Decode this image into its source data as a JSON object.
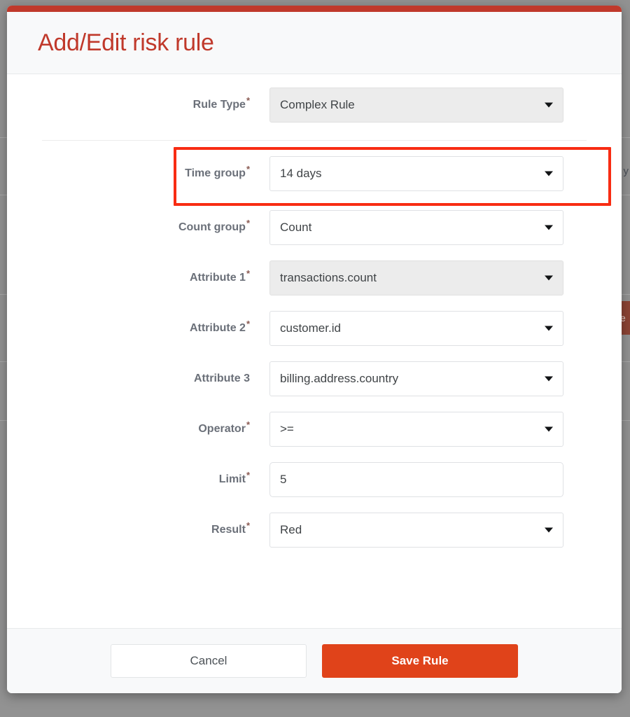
{
  "background": {
    "right_text": "y",
    "right_badge": "ve"
  },
  "modal": {
    "title": "Add/Edit risk rule",
    "accent_color": "#c0392b",
    "highlight_color": "#f82c13",
    "required_marker": "*",
    "caret_icon": "chevron-down-icon",
    "form": {
      "rows": [
        {
          "label": "Rule Type",
          "required": true,
          "control": "select",
          "value": "Complex Rule",
          "disabled": true,
          "highlighted": false
        },
        {
          "label": "Time group",
          "required": true,
          "control": "select",
          "value": "14 days",
          "disabled": false,
          "highlighted": true
        },
        {
          "label": "Count group",
          "required": true,
          "control": "select",
          "value": "Count",
          "disabled": false,
          "highlighted": false
        },
        {
          "label": "Attribute 1",
          "required": true,
          "control": "select",
          "value": "transactions.count",
          "disabled": true,
          "highlighted": false
        },
        {
          "label": "Attribute 2",
          "required": true,
          "control": "select",
          "value": "customer.id",
          "disabled": false,
          "highlighted": false
        },
        {
          "label": "Attribute 3",
          "required": false,
          "control": "select",
          "value": "billing.address.country",
          "disabled": false,
          "highlighted": false
        },
        {
          "label": "Operator",
          "required": true,
          "control": "select",
          "value": ">=",
          "disabled": false,
          "highlighted": false
        },
        {
          "label": "Limit",
          "required": true,
          "control": "text",
          "value": "5",
          "disabled": false,
          "highlighted": false
        },
        {
          "label": "Result",
          "required": true,
          "control": "select",
          "value": "Red",
          "disabled": false,
          "highlighted": false
        }
      ]
    },
    "footer": {
      "cancel_label": "Cancel",
      "save_label": "Save Rule",
      "save_color": "#e0431a"
    }
  }
}
